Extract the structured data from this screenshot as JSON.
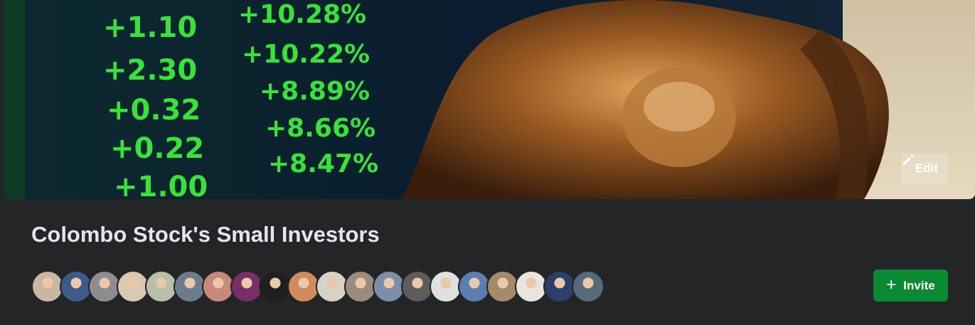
{
  "cover": {
    "left_ticker": [
      "+1.10",
      "+2.30",
      "+0.32",
      "+0.22",
      "+1.00"
    ],
    "right_ticker": [
      "+10.28%",
      "+10.22%",
      "+8.89%",
      "+8.66%",
      "+8.47%"
    ],
    "edit_label": "Edit"
  },
  "group": {
    "name": "Colombo Stock's Small Investors"
  },
  "members": {
    "avatar_colors": [
      "#c9b7a3",
      "#3d5a8a",
      "#8d8d8d",
      "#d8c9b0",
      "#b8c0a8",
      "#6b7d8c",
      "#c78a7a",
      "#7a2e66",
      "#1f1f1f",
      "#d08a5c",
      "#d7d2c8",
      "#9b8a7d",
      "#7a8fa8",
      "#5d5d5d",
      "#e0e0e0",
      "#5a7fb0",
      "#a58a6a",
      "#e8e4de",
      "#2b3f6b",
      "#556b7a"
    ]
  },
  "actions": {
    "invite_label": "Invite"
  },
  "colors": {
    "background": "#242526",
    "invite_green": "#0a8a33",
    "ticker_green": "#39e23a"
  }
}
